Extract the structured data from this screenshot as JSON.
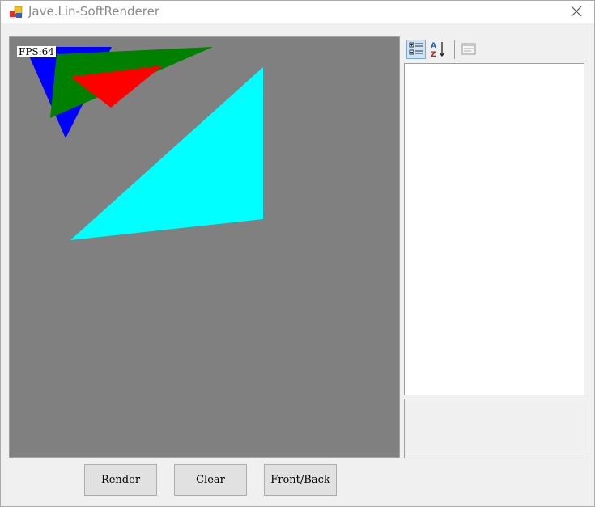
{
  "window": {
    "title": "Jave.Lin-SoftRenderer"
  },
  "viewport": {
    "fps_text": "FPS:64",
    "background": "#808080",
    "triangles": [
      {
        "name": "blue",
        "color": "#0000ff"
      },
      {
        "name": "green",
        "color": "#008000"
      },
      {
        "name": "red",
        "color": "#ff0000"
      },
      {
        "name": "cyan",
        "color": "#00ffff"
      }
    ]
  },
  "property_toolbar": {
    "items": [
      {
        "icon": "categorized-icon",
        "active": true
      },
      {
        "icon": "alphabetical-sort-icon",
        "active": false
      },
      {
        "icon": "property-pages-icon",
        "active": false
      }
    ]
  },
  "buttons": {
    "render_label": "Render",
    "clear_label": "Clear",
    "front_back_label": "Front/Back"
  }
}
